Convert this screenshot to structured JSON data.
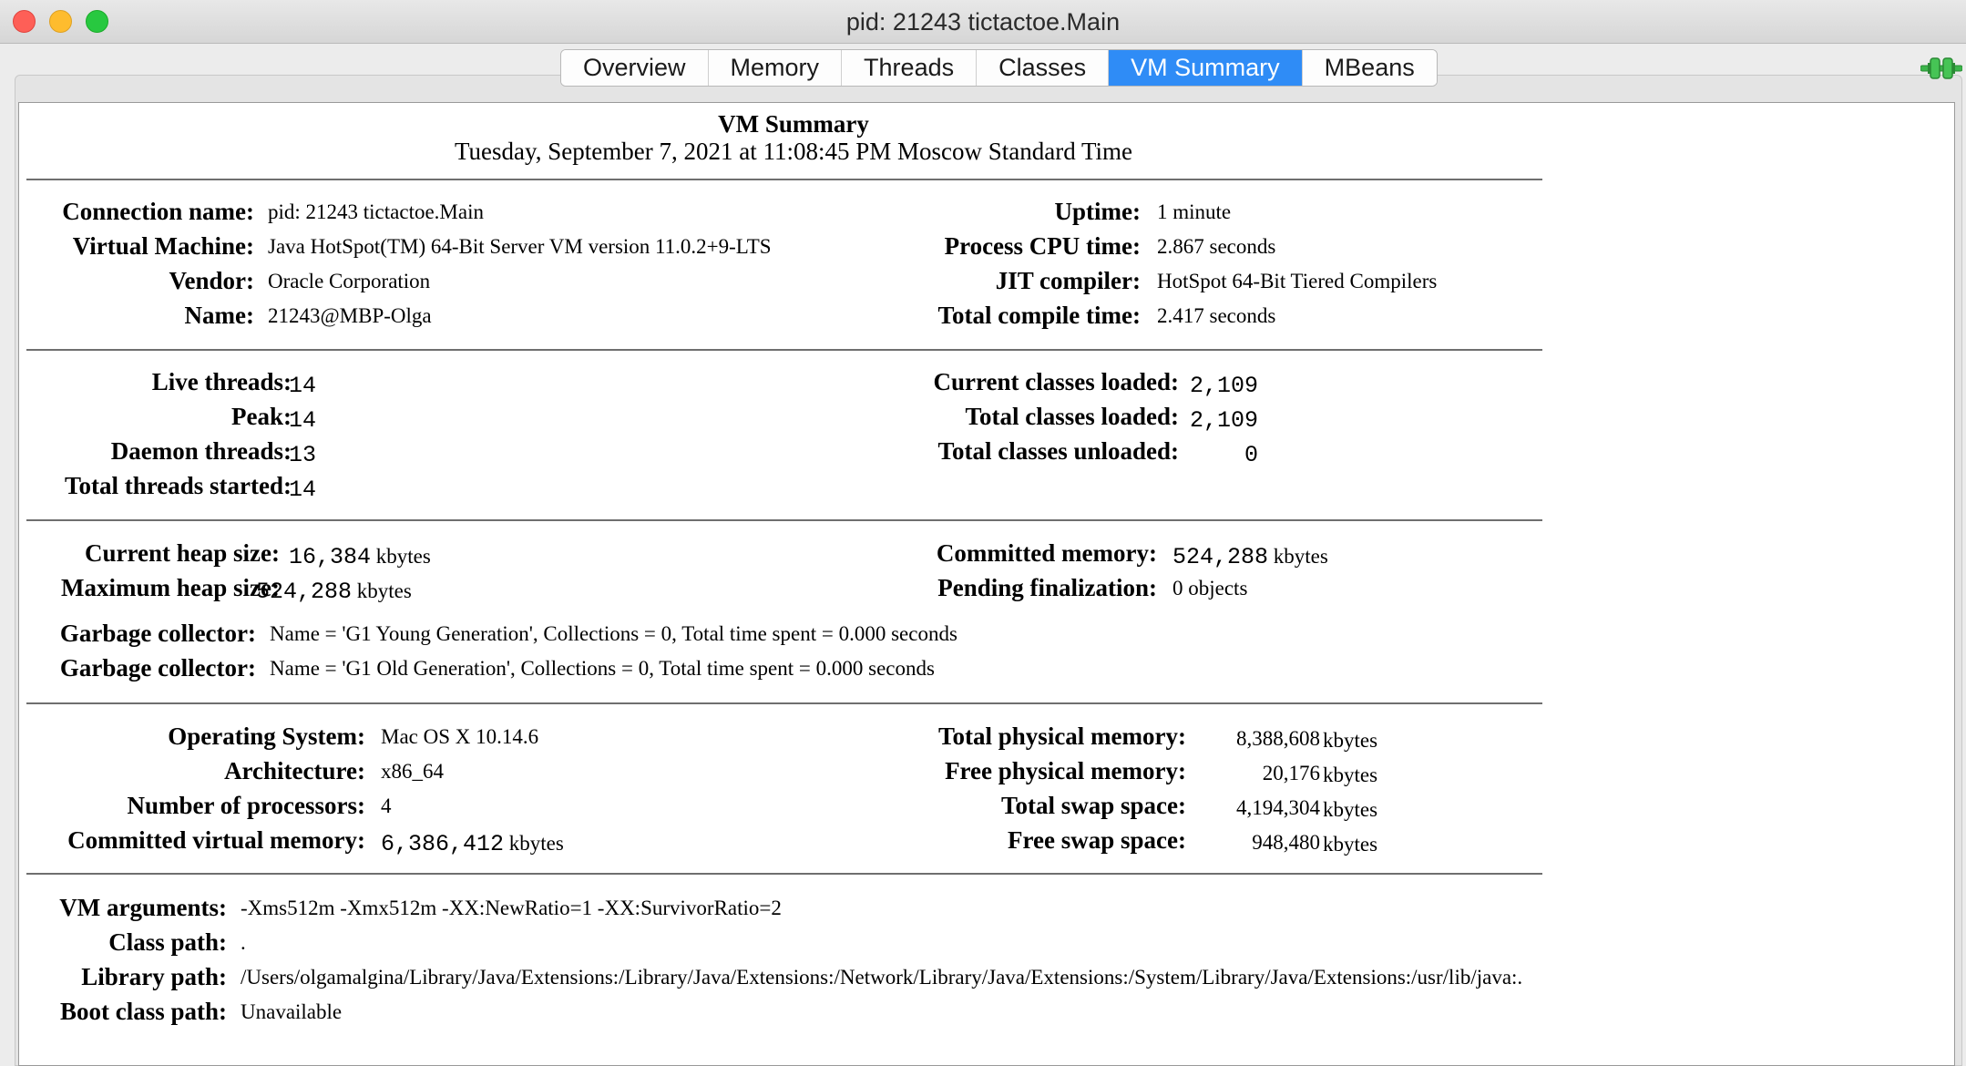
{
  "window": {
    "title": "pid: 21243 tictactoe.Main",
    "controls": [
      "close",
      "minimize",
      "zoom"
    ]
  },
  "tabs": [
    {
      "label": "Overview",
      "active": false
    },
    {
      "label": "Memory",
      "active": false
    },
    {
      "label": "Threads",
      "active": false
    },
    {
      "label": "Classes",
      "active": false
    },
    {
      "label": "VM Summary",
      "active": true
    },
    {
      "label": "MBeans",
      "active": false
    }
  ],
  "connection_icon": "plug-connected-icon",
  "colors": {
    "active_tab": "#2f8cf6",
    "connection_icon": "#3bb54a"
  },
  "summary": {
    "title": "VM Summary",
    "date": "Tuesday, September 7, 2021 at 11:08:45 PM Moscow Standard Time"
  },
  "vm_info": {
    "connection_name": {
      "label": "Connection name:",
      "value": "pid: 21243 tictactoe.Main"
    },
    "virtual_machine": {
      "label": "Virtual Machine:",
      "value": "Java HotSpot(TM) 64-Bit Server VM version 11.0.2+9-LTS"
    },
    "vendor": {
      "label": "Vendor:",
      "value": "Oracle Corporation"
    },
    "name": {
      "label": "Name:",
      "value": "21243@MBP-Olga"
    },
    "uptime": {
      "label": "Uptime:",
      "value": "1 minute"
    },
    "process_cpu_time": {
      "label": "Process CPU time:",
      "value": "2.867 seconds"
    },
    "jit_compiler": {
      "label": "JIT compiler:",
      "value": "HotSpot 64-Bit Tiered Compilers"
    },
    "total_compile_time": {
      "label": "Total compile time:",
      "value": "2.417 seconds"
    }
  },
  "threads": {
    "live": {
      "label": "Live threads:",
      "value": "14"
    },
    "peak": {
      "label": "Peak:",
      "value": "14"
    },
    "daemon": {
      "label": "Daemon threads:",
      "value": "13"
    },
    "total_started": {
      "label": "Total threads started:",
      "value": "14"
    }
  },
  "classes": {
    "current_loaded": {
      "label": "Current classes loaded:",
      "value": "2,109"
    },
    "total_loaded": {
      "label": "Total classes loaded:",
      "value": "2,109"
    },
    "total_unloaded": {
      "label": "Total classes unloaded:",
      "value": "0"
    }
  },
  "memory": {
    "current_heap": {
      "label": "Current heap size:",
      "value": "16,384",
      "unit": "kbytes"
    },
    "max_heap": {
      "label": "Maximum heap size:",
      "value": "524,288",
      "unit": "kbytes"
    },
    "committed": {
      "label": "Committed memory:",
      "value": "524,288",
      "unit": "kbytes"
    },
    "pending_finalization": {
      "label": "Pending finalization:",
      "value": "0 objects"
    },
    "gc": [
      {
        "label": "Garbage collector:",
        "value": "Name = 'G1 Young Generation', Collections = 0, Total time spent = 0.000 seconds"
      },
      {
        "label": "Garbage collector:",
        "value": "Name = 'G1 Old Generation', Collections = 0, Total time spent = 0.000 seconds"
      }
    ]
  },
  "os": {
    "operating_system": {
      "label": "Operating System:",
      "value": "Mac OS X 10.14.6"
    },
    "architecture": {
      "label": "Architecture:",
      "value": "x86_64"
    },
    "processors": {
      "label": "Number of processors:",
      "value": "4"
    },
    "committed_virtual": {
      "label": "Committed virtual memory:",
      "value": "6,386,412",
      "unit": "kbytes"
    },
    "total_physical": {
      "label": "Total physical memory:",
      "value": "8,388,608",
      "unit": "kbytes"
    },
    "free_physical": {
      "label": "Free physical memory:",
      "value": "20,176",
      "unit": "kbytes"
    },
    "total_swap": {
      "label": "Total swap space:",
      "value": "4,194,304",
      "unit": "kbytes"
    },
    "free_swap": {
      "label": "Free swap space:",
      "value": "948,480",
      "unit": "kbytes"
    }
  },
  "paths": {
    "vm_arguments": {
      "label": "VM arguments:",
      "value": "-Xms512m -Xmx512m -XX:NewRatio=1 -XX:SurvivorRatio=2"
    },
    "class_path": {
      "label": "Class path:",
      "value": "."
    },
    "library_path": {
      "label": "Library path:",
      "value": "/Users/olgamalgina/Library/Java/Extensions:/Library/Java/Extensions:/Network/Library/Java/Extensions:/System/Library/Java/Extensions:/usr/lib/java:."
    },
    "boot_class_path": {
      "label": "Boot class path:",
      "value": "Unavailable"
    }
  }
}
